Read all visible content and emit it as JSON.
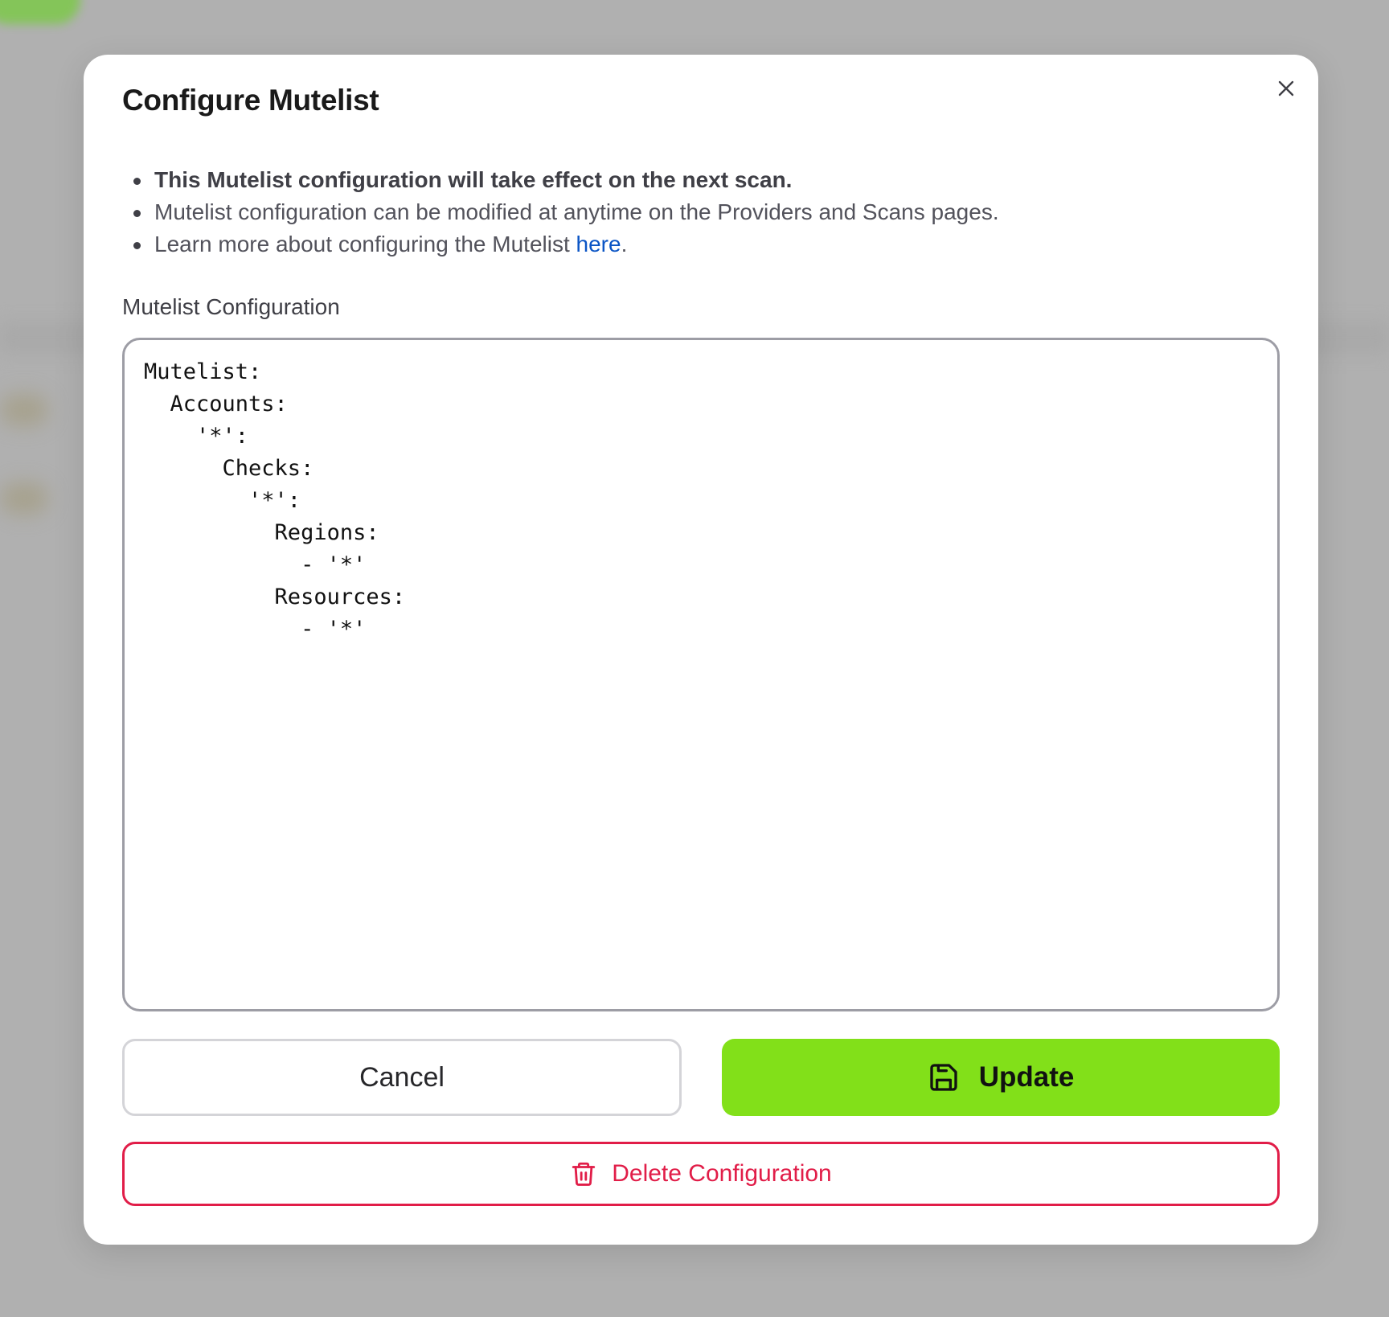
{
  "modal": {
    "title": "Configure Mutelist",
    "close_icon": "close-icon"
  },
  "info": {
    "items": [
      "This Mutelist configuration will take effect on the next scan.",
      "Mutelist configuration can be modified at anytime on the Providers and Scans pages."
    ],
    "learn_more_prefix": "Learn more about configuring the Mutelist ",
    "learn_more_link": "here",
    "learn_more_suffix": "."
  },
  "editor": {
    "label": "Mutelist Configuration",
    "value": "Mutelist:\n  Accounts:\n    '*':\n      Checks:\n        '*':\n          Regions:\n            - '*'\n          Resources:\n            - '*'"
  },
  "actions": {
    "cancel_label": "Cancel",
    "update_label": "Update",
    "update_icon": "save-icon",
    "delete_label": "Delete Configuration",
    "delete_icon": "trash-icon"
  },
  "colors": {
    "accent": "#82e019",
    "danger": "#e11d48",
    "link": "#0b55c5",
    "overlay": "#b0b0b0"
  }
}
